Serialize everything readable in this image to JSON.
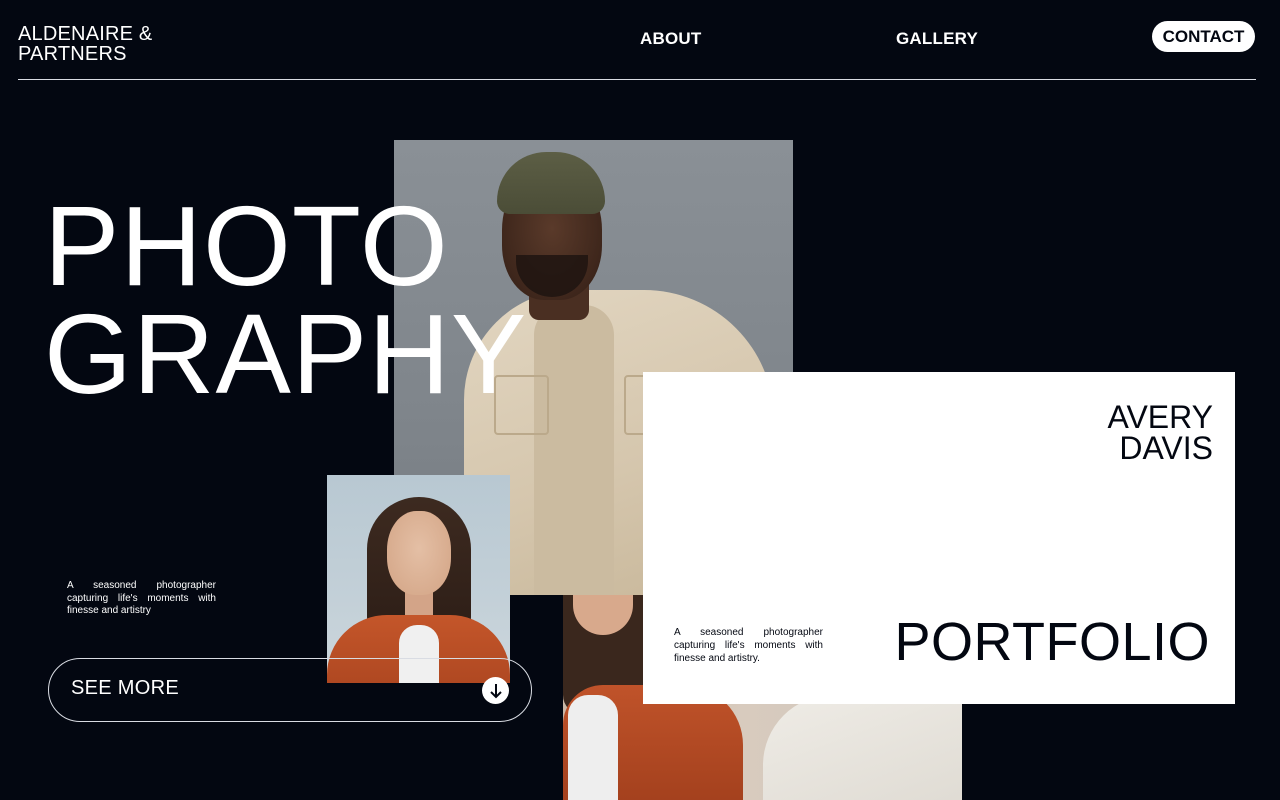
{
  "header": {
    "brand_line1": "ALDENAIRE &",
    "brand_line2": "PARTNERS",
    "nav": {
      "about": "ABOUT",
      "gallery": "GALLERY",
      "contact": "CONTACT"
    }
  },
  "hero": {
    "title_line1": "PHOTO",
    "title_line2": "GRAPHY",
    "description": "A seasoned photographer capturing life's moments with finesse and artistry",
    "cta_label": "SEE MORE",
    "cta_icon": "arrow-down-icon"
  },
  "card": {
    "name_line1": "AVERY",
    "name_line2": "DAVIS",
    "description": "A seasoned photographer capturing life's moments with finesse and artistry.",
    "title": "PORTFOLIO"
  },
  "colors": {
    "background": "#030711",
    "text": "#ffffff",
    "card": "#ffffff",
    "accent_dark": "#030711"
  }
}
